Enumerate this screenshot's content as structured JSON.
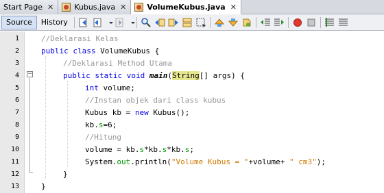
{
  "tabs": [
    {
      "label": "Start Page",
      "closable": true,
      "active": false,
      "icon": "none"
    },
    {
      "label": "Kubus.java",
      "closable": true,
      "active": false,
      "icon": "java-file-icon"
    },
    {
      "label": "VolumeKubus.java",
      "closable": true,
      "active": true,
      "icon": "java-file-icon"
    }
  ],
  "toolbar": {
    "source_label": "Source",
    "history_label": "History"
  },
  "editor": {
    "line_numbers": [
      "1",
      "2",
      "3",
      "4",
      "5",
      "6",
      "7",
      "8",
      "9",
      "10",
      "11",
      "12",
      "13"
    ],
    "lines": [
      "//Deklarasi Kelas",
      "public class VolumeKubus {",
      "//Deklarasi Method Utama",
      "public static void main(String[] args) {",
      "int volume;",
      "//Instan objek dari class kubus",
      "Kubus kb = new Kubus();",
      "kb.s=6;",
      "//Hitung",
      "volume = kb.s*kb.s*kb.s;",
      "System.out.println(\"Volume Kubus = \"+volume+ \" cm3\");",
      "}",
      "}"
    ]
  },
  "colors": {
    "keyword": "#0000e6",
    "comment": "#969696",
    "string": "#ce7b00",
    "field": "#009900",
    "highlight": "#e6e68f"
  }
}
